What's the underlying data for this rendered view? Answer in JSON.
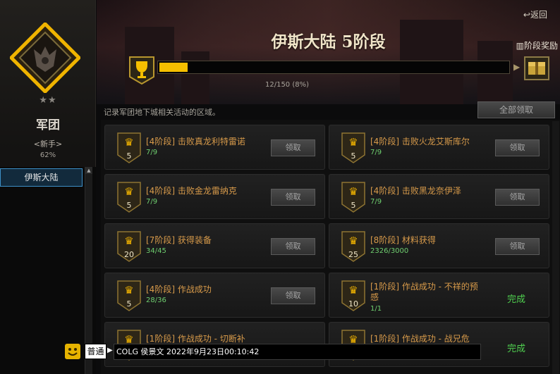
{
  "colors": {
    "accent_gold": "#f5bf00",
    "mission_title": "#d79a4a",
    "count_green": "#6fcf6f",
    "done_green": "#4fd04f",
    "selected_blue": "#3d8fc7"
  },
  "sidebar": {
    "stars": "★★",
    "rank_title": "军团",
    "rank_level": "<新手>",
    "rank_percent": "62%",
    "regions": [
      {
        "label": "伊斯大陆",
        "selected": true
      }
    ]
  },
  "header": {
    "back_label": "返回",
    "back_icon": "return-arrow-icon",
    "title": "伊斯大陆 5阶段",
    "stage_reward_label": "阶段奖励",
    "stage_reward_icon": "gift-icon",
    "reward_box_icon": "reward-chest-icon",
    "progress": {
      "current": 12,
      "total": 150,
      "fraction": 0.08,
      "text": "12/150 (8%)"
    }
  },
  "description": "记录军团地下城相关活动的区域。",
  "claim_all_label": "全部领取",
  "missions": [
    {
      "stage": "5",
      "title": "[4阶段] 击败真龙利特雷诺",
      "count": "7/9",
      "status": "claim",
      "button": "领取"
    },
    {
      "stage": "5",
      "title": "[4阶段] 击败火龙艾斯库尔",
      "count": "7/9",
      "status": "claim",
      "button": "领取"
    },
    {
      "stage": "5",
      "title": "[4阶段] 击败金龙雷纳克",
      "count": "7/9",
      "status": "claim",
      "button": "领取"
    },
    {
      "stage": "5",
      "title": "[4阶段] 击败黑龙奈伊泽",
      "count": "7/9",
      "status": "claim",
      "button": "领取"
    },
    {
      "stage": "20",
      "title": "[7阶段] 获得装备",
      "count": "34/45",
      "status": "claim",
      "button": "领取"
    },
    {
      "stage": "25",
      "title": "[8阶段] 材料获得",
      "count": "2326/3000",
      "status": "claim",
      "button": "领取"
    },
    {
      "stage": "5",
      "title": "[4阶段] 作战成功",
      "count": "28/36",
      "status": "claim",
      "button": "领取"
    },
    {
      "stage": "10",
      "title": "[1阶段] 作战成功 - 不祥的预感",
      "count": "1/1",
      "status": "done",
      "button": "完成"
    },
    {
      "stage": "",
      "title": "[1阶段] 作战成功 - 切断补",
      "count": "",
      "status": "partial",
      "button": ""
    },
    {
      "stage": "",
      "title": "[1阶段] 作战成功 - 战兄危",
      "count": "",
      "status": "done",
      "button": "完成"
    }
  ],
  "chat": {
    "channel": "普通",
    "arrow": "▶",
    "emote_icon": "smiley-face-icon",
    "message": "COLG 侯景文 2022年9月23日00:10:42"
  }
}
